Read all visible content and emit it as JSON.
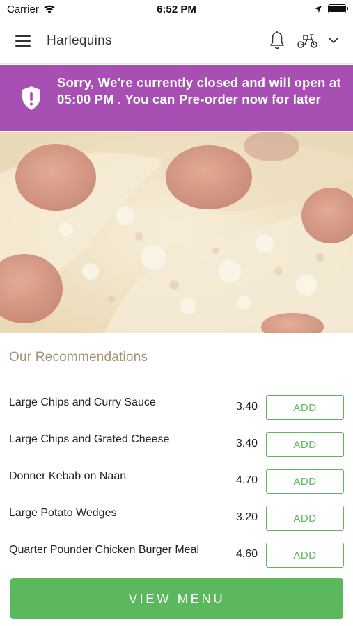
{
  "status_bar": {
    "carrier": "Carrier",
    "time": "6:52 PM"
  },
  "header": {
    "title": "Harlequins",
    "icons": [
      "hamburger-menu-icon",
      "bell-icon",
      "scooter-icon",
      "chevron-down-icon"
    ]
  },
  "banner": {
    "text": "Sorry, We're currently closed and will open at 05:00 PM . You can Pre-order now for later",
    "background_color": "#a84fb3",
    "icon": "shield-alert-icon"
  },
  "recommendations": {
    "title": "Our Recommendations",
    "items": [
      {
        "name": "Large Chips and Curry Sauce",
        "price": "3.40",
        "action": "ADD"
      },
      {
        "name": "Large Chips and Grated Cheese",
        "price": "3.40",
        "action": "ADD"
      },
      {
        "name": "Donner Kebab on Naan",
        "price": "4.70",
        "action": "ADD"
      },
      {
        "name": "Large Potato Wedges",
        "price": "3.20",
        "action": "ADD"
      },
      {
        "name": "Quarter Pounder Chicken Burger Meal",
        "price": "4.60",
        "action": "ADD"
      }
    ]
  },
  "footer": {
    "button_label": "VIEW MENU"
  },
  "colors": {
    "accent_green": "#5cb85c",
    "banner_purple": "#a84fb3",
    "section_title": "#a39573"
  }
}
